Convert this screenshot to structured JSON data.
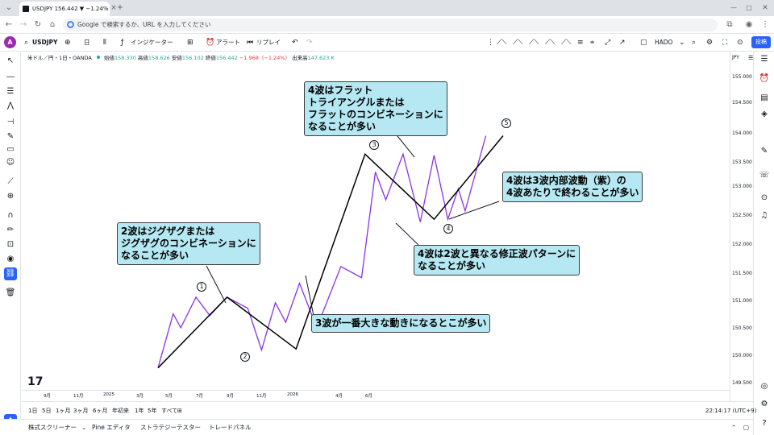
{
  "browser": {
    "tab_title": "USDJPY 156.442 ▼ −1.24% 無...",
    "tab_close": "×",
    "new_tab": "+",
    "omnibox_placeholder": "Google で検索するか、URL を入力してください"
  },
  "toolbar": {
    "avatar": "A",
    "symbol": "USDJPY",
    "interval": "日",
    "indicators_label": "インジケーター",
    "alert_label": "アラート",
    "replay_label": "リプレイ",
    "layout_name": "HADO",
    "publish_label": "投稿"
  },
  "legend": {
    "title": "米ドル／円・1日・OANDA",
    "open_label": "始値",
    "open": "158.330",
    "high_label": "高値",
    "high": "158.626",
    "low_label": "安値",
    "low": "156.102",
    "close_label": "終値",
    "close": "156.442",
    "change": "−1.968（−1.24%）",
    "volume_label": "出来高",
    "volume": "147.623 K"
  },
  "price_axis": {
    "currency": "JPY",
    "labels": [
      "155.000",
      "154.500",
      "154.000",
      "153.500",
      "153.000",
      "152.500",
      "152.000",
      "151.500",
      "151.000",
      "150.500",
      "150.000",
      "149.500"
    ]
  },
  "time_axis": {
    "labels": [
      "9月",
      "11月",
      "2025",
      "3月",
      "5月",
      "7月",
      "9月",
      "11月",
      "2026",
      "4月",
      "6月"
    ]
  },
  "range_bar": {
    "items": [
      "1日",
      "5日",
      "1ヶ月",
      "3ヶ月",
      "6ヶ月",
      "年初来",
      "1年",
      "5年",
      "すべて"
    ],
    "clock": "22:14:17 (UTC+9)"
  },
  "bottom_bar": {
    "items": [
      "株式スクリーナー",
      "Pine エディタ",
      "ストラテジーテスター",
      "トレードパネル"
    ]
  },
  "annotations": {
    "wave2": [
      "2波はジグザグまたは",
      "ジグザグのコンビネーションに",
      "なることが多い"
    ],
    "wave3": [
      "3波が一番大きな動きになるとこが多い"
    ],
    "wave4_flat": [
      "4波はフラット",
      "トライアングルまたは",
      "フラットのコンビネーションに",
      "なることが多い"
    ],
    "wave4_internal": [
      "4波は3波内部波動（紫）の",
      "4波あたりで終わることが多い"
    ],
    "wave4_alternate": [
      "4波は2波と異なる修正波パターンに",
      "なることが多い"
    ],
    "wave_labels": [
      "1",
      "2",
      "3",
      "4",
      "5"
    ]
  },
  "colors": {
    "callout_bg": "#b5e8f2",
    "main_wave": "#000000",
    "sub_wave": "#8b32e6",
    "accent": "#2962ff"
  },
  "waves": {
    "main": [
      {
        "t": 0,
        "p": 149.78
      },
      {
        "t": 1,
        "p": 151.05
      },
      {
        "t": 2,
        "p": 150.12
      },
      {
        "t": 3,
        "p": 153.62
      },
      {
        "t": 4,
        "p": 152.45
      },
      {
        "t": 5,
        "p": 153.95
      }
    ],
    "sub": [
      {
        "t": 0.0,
        "p": 149.78
      },
      {
        "t": 0.22,
        "p": 150.75
      },
      {
        "t": 0.33,
        "p": 150.5
      },
      {
        "t": 0.55,
        "p": 151.05
      },
      {
        "t": 0.75,
        "p": 150.72
      },
      {
        "t": 1.0,
        "p": 151.05
      },
      {
        "t": 1.3,
        "p": 150.85
      },
      {
        "t": 1.5,
        "p": 150.1
      },
      {
        "t": 1.7,
        "p": 150.95
      },
      {
        "t": 1.85,
        "p": 150.6
      },
      {
        "t": 2.05,
        "p": 151.3
      },
      {
        "t": 2.3,
        "p": 150.5
      },
      {
        "t": 2.65,
        "p": 151.6
      },
      {
        "t": 2.95,
        "p": 151.4
      },
      {
        "t": 3.15,
        "p": 153.3
      },
      {
        "t": 3.3,
        "p": 152.8
      },
      {
        "t": 3.55,
        "p": 153.62
      },
      {
        "t": 3.8,
        "p": 152.4
      },
      {
        "t": 4.0,
        "p": 153.6
      },
      {
        "t": 4.2,
        "p": 152.45
      },
      {
        "t": 4.35,
        "p": 153.0
      },
      {
        "t": 4.45,
        "p": 152.6
      },
      {
        "t": 4.75,
        "p": 153.95
      }
    ]
  }
}
